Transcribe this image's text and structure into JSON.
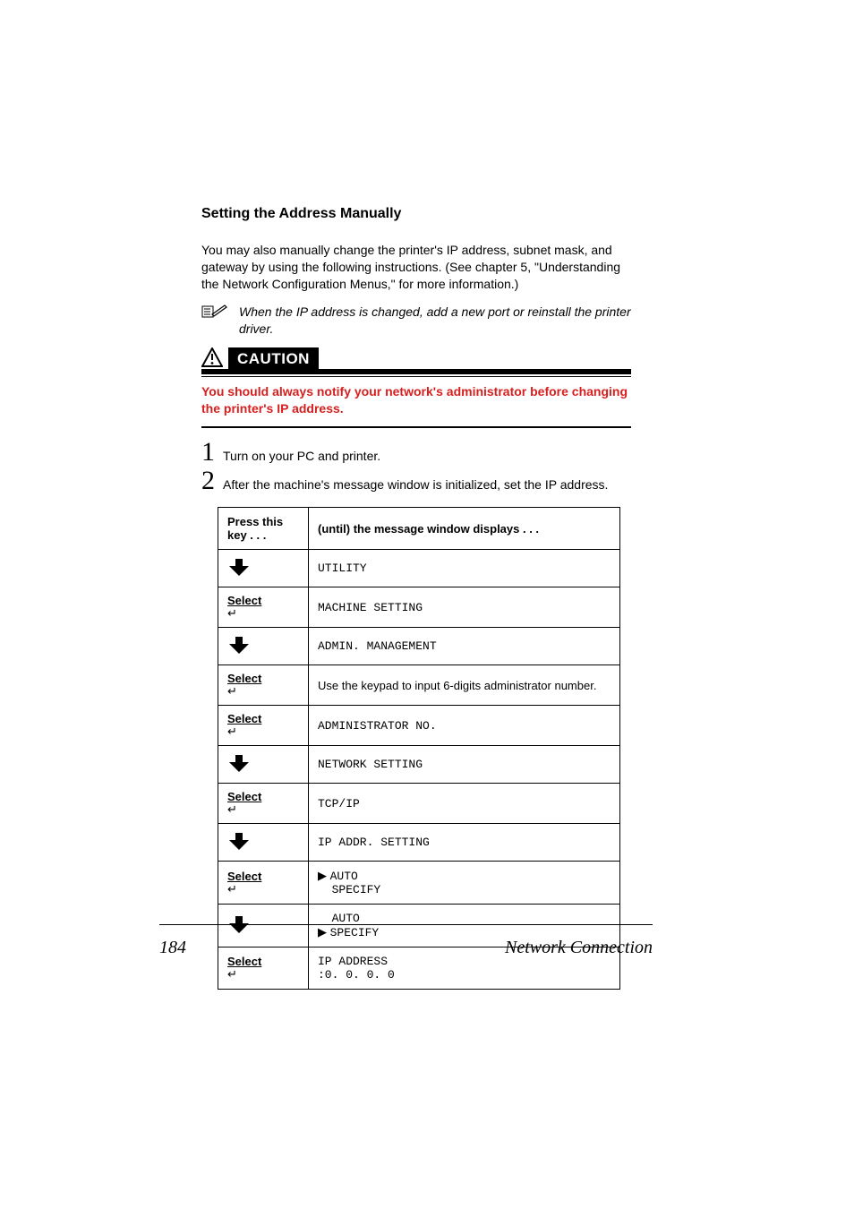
{
  "headings": {
    "section": "Setting the Address Manually"
  },
  "paragraphs": {
    "intro": "You may also manually change the printer's IP address, subnet mask, and gateway by using the following instructions. (See chapter 5, \"Understanding the Network Configuration Menus,\" for more information.)",
    "note": "When the IP address is changed, add a new port or reinstall the printer driver."
  },
  "caution": {
    "label": "CAUTION",
    "text": "You should always notify your network's administrator before changing the printer's IP address."
  },
  "steps": {
    "s1": {
      "num": "1",
      "text": "Turn on your PC and printer."
    },
    "s2": {
      "num": "2",
      "text": "After the machine's message window is initialized, set the IP address."
    }
  },
  "table": {
    "header": {
      "col1": "Press this key . . .",
      "col2": "(until) the message window displays . . ."
    },
    "select_label": "Select",
    "rows": {
      "r1": {
        "key": "down",
        "msg": "UTILITY"
      },
      "r2": {
        "key": "select",
        "msg": "MACHINE SETTING"
      },
      "r3": {
        "key": "down",
        "msg": "ADMIN. MANAGEMENT"
      },
      "r4": {
        "key": "select",
        "msg_plain": "Use the keypad to input 6-digits administrator number."
      },
      "r5": {
        "key": "select",
        "msg": "ADMINISTRATOR NO."
      },
      "r6": {
        "key": "down",
        "msg": "NETWORK SETTING"
      },
      "r7": {
        "key": "select",
        "msg": "TCP/IP"
      },
      "r8": {
        "key": "down",
        "msg": "IP ADDR. SETTING"
      },
      "r9": {
        "key": "select",
        "line1": "AUTO",
        "line2": "SPECIFY",
        "arrow_on": 1
      },
      "r10": {
        "key": "down",
        "line1": "AUTO",
        "line2": "SPECIFY",
        "arrow_on": 2
      },
      "r11": {
        "key": "select",
        "line1": "IP ADDRESS",
        "line2": " :0.  0.  0.  0"
      }
    }
  },
  "footer": {
    "page": "184",
    "title": "Network Connection"
  }
}
